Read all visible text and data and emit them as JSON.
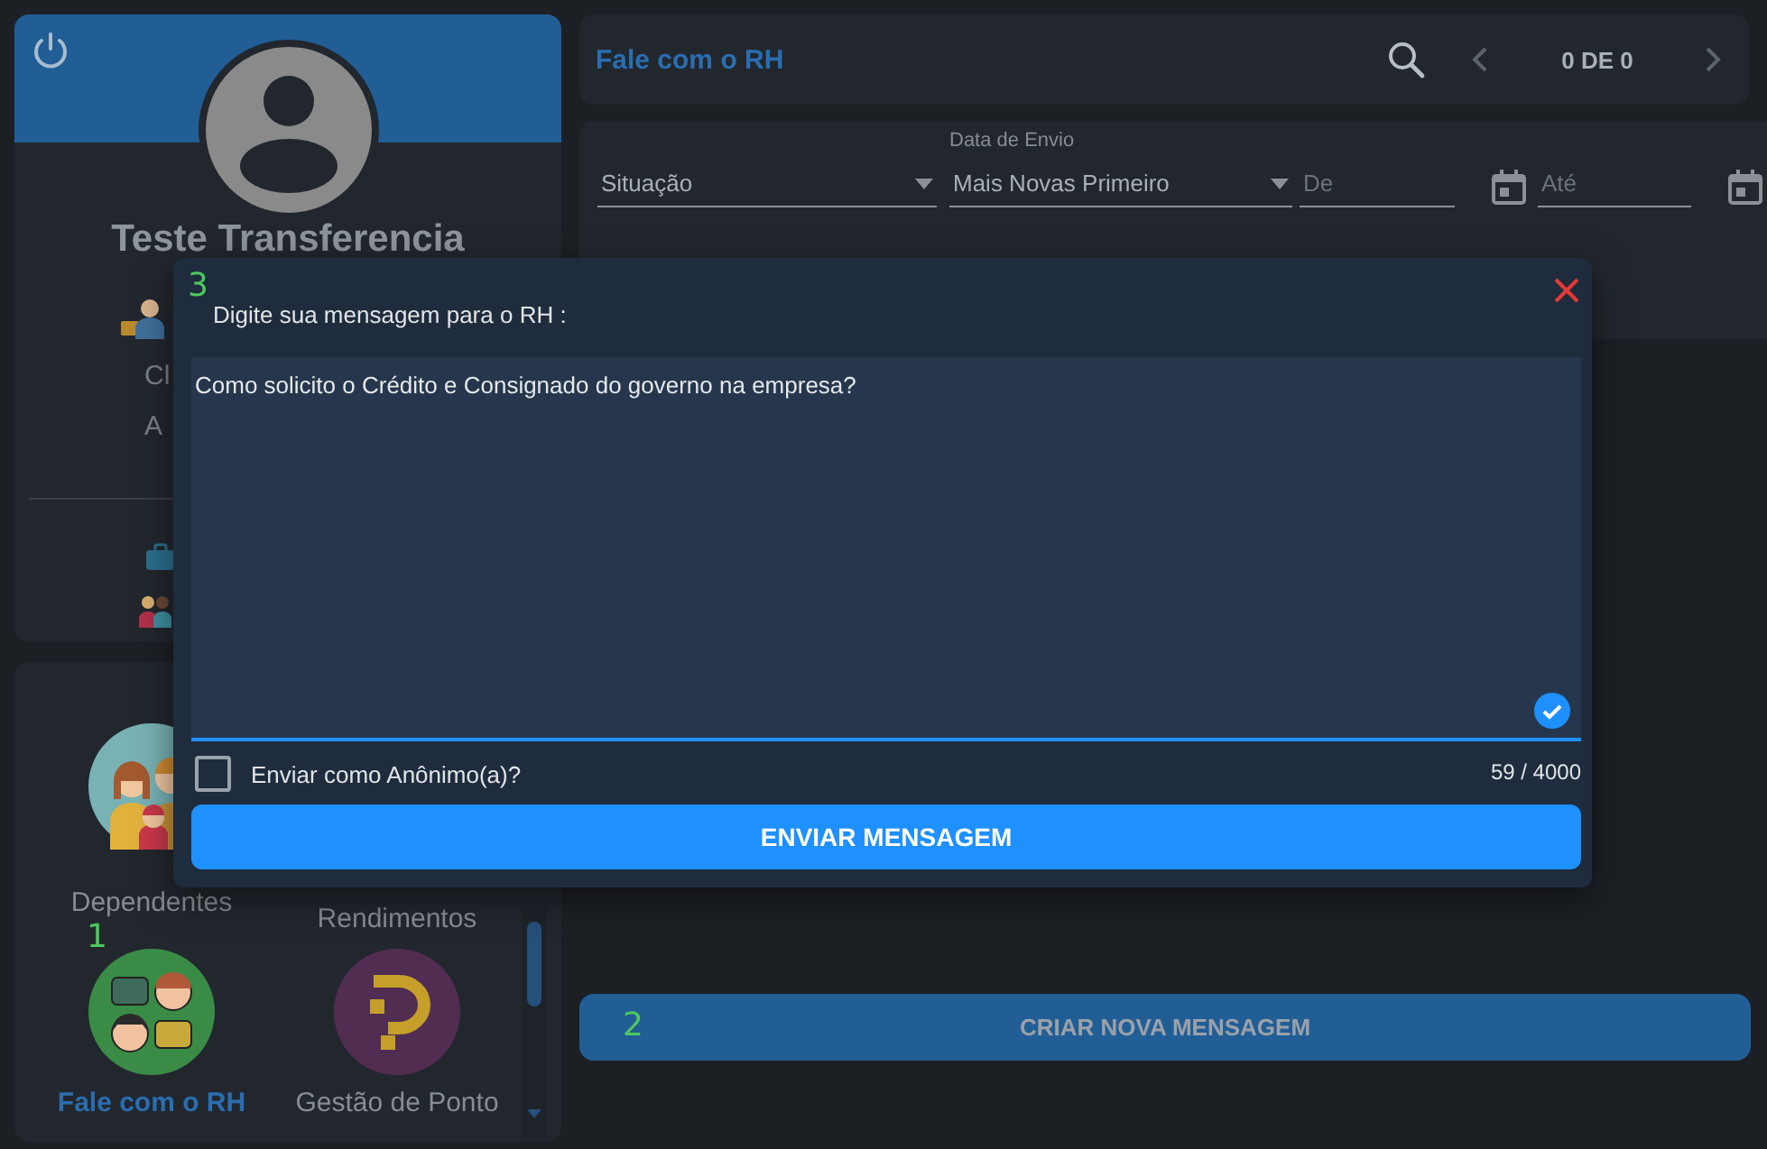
{
  "profile": {
    "name": "Teste Transferencia",
    "lines": [
      "Cl",
      "A"
    ]
  },
  "menu": {
    "marker": "1",
    "items": [
      {
        "label": "Dependentes",
        "selected": false,
        "kind": "family"
      },
      {
        "label": "Rendimentos",
        "selected": false,
        "kind": "hidden"
      },
      {
        "label": "Fale com o RH",
        "selected": true,
        "kind": "chat"
      },
      {
        "label": "Gestão de Ponto",
        "selected": false,
        "kind": "hook"
      }
    ]
  },
  "header": {
    "title": "Fale com o RH",
    "pager": "0 DE 0"
  },
  "filters": {
    "status": {
      "placeholder": "Situação"
    },
    "date_label": "Data de Envio",
    "order": {
      "value": "Mais Novas Primeiro"
    },
    "from": {
      "placeholder": "De"
    },
    "to": {
      "placeholder": "Até"
    }
  },
  "create_button": {
    "label": "CRIAR NOVA MENSAGEM",
    "marker": "2"
  },
  "dialog": {
    "marker": "3",
    "label": "Digite sua mensagem para o RH :",
    "message": "Como solicito o Crédito e Consignado do governo na empresa?",
    "valid": true,
    "anonymous": {
      "label": "Enviar como Anônimo(a)?",
      "checked": false
    },
    "counter": "59 / 4000",
    "send_button": "ENVIAR MENSAGEM"
  }
}
